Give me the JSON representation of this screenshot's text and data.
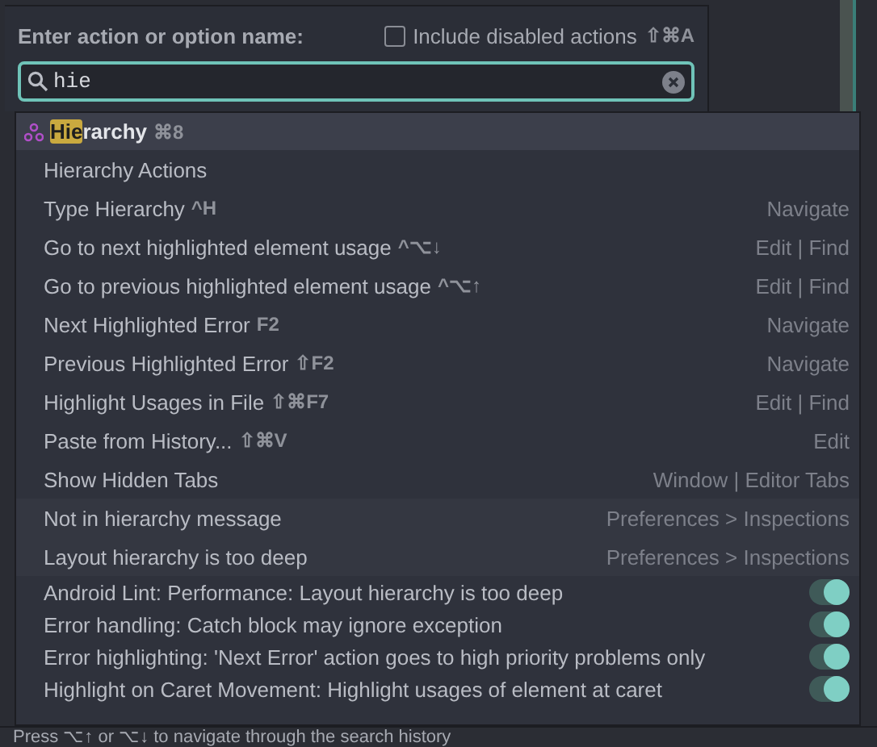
{
  "header": {
    "label": "Enter action or option name:",
    "include_disabled": {
      "label": "Include disabled actions",
      "shortcut": "⇧⌘A",
      "checked": false
    }
  },
  "search": {
    "value": "hie"
  },
  "results": [
    {
      "kind": "action",
      "match": "Hie",
      "rest": "rarchy",
      "shortcut": "⌘8",
      "selected": true,
      "icon": true
    },
    {
      "kind": "action",
      "label": "Hierarchy Actions",
      "selected": false
    },
    {
      "kind": "action",
      "label": "Type Hierarchy",
      "shortcut": "^H",
      "group": "Navigate",
      "selected": false
    },
    {
      "kind": "action",
      "label": "Go to next highlighted element usage",
      "shortcut": "^⌥↓",
      "group": "Edit | Find",
      "selected": false
    },
    {
      "kind": "action",
      "label": "Go to previous highlighted element usage",
      "shortcut": "^⌥↑",
      "group": "Edit | Find",
      "selected": false
    },
    {
      "kind": "action",
      "label": "Next Highlighted Error",
      "shortcut": "F2",
      "group": "Navigate",
      "selected": false
    },
    {
      "kind": "action",
      "label": "Previous Highlighted Error",
      "shortcut": "⇧F2",
      "group": "Navigate",
      "selected": false
    },
    {
      "kind": "action",
      "label": "Highlight Usages in File",
      "shortcut": "⇧⌘F7",
      "group": "Edit | Find",
      "selected": false
    },
    {
      "kind": "action",
      "label": "Paste from History...",
      "shortcut": "⇧⌘V",
      "group": "Edit",
      "selected": false
    },
    {
      "kind": "action",
      "label": "Show Hidden Tabs",
      "group": "Window | Editor Tabs",
      "selected": false
    },
    {
      "kind": "preference",
      "label": "Not in hierarchy message",
      "group": "Preferences > Inspections",
      "selected": false
    },
    {
      "kind": "preference",
      "label": "Layout hierarchy is too deep",
      "group": "Preferences > Inspections",
      "selected": false
    },
    {
      "kind": "option",
      "label": "Android Lint: Performance: Layout hierarchy is too deep",
      "on": true,
      "selected": false
    },
    {
      "kind": "option",
      "label": "Error handling: Catch block may ignore exception",
      "on": true,
      "selected": false
    },
    {
      "kind": "option",
      "label": "Error highlighting: 'Next Error' action goes to high priority problems only",
      "on": true,
      "selected": false
    },
    {
      "kind": "option",
      "label": "Highlight on Caret Movement: Highlight usages of element at caret",
      "on": true,
      "selected": false
    }
  ],
  "status_bar": "Press ⌥↑ or ⌥↓ to navigate through the search history"
}
